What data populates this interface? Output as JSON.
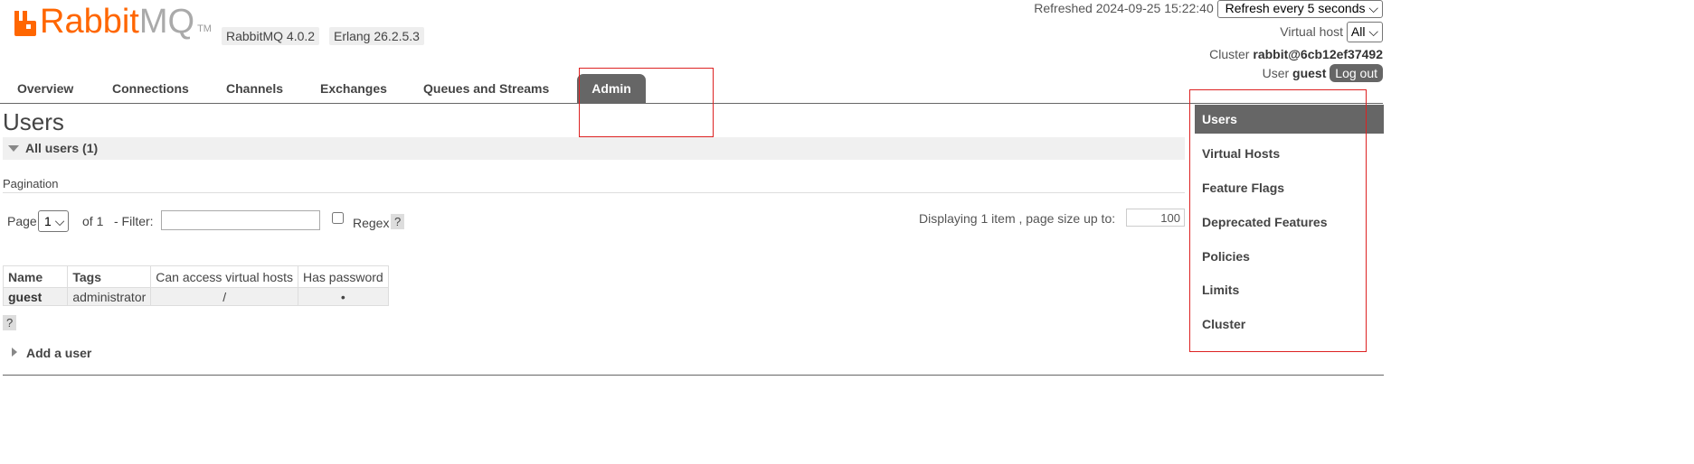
{
  "header": {
    "logo_rabbit": "Rabbit",
    "logo_mq": "MQ",
    "logo_tm": "TM",
    "version_rabbitmq": "RabbitMQ 4.0.2",
    "version_erlang": "Erlang 26.2.5.3",
    "refreshed_text": "Refreshed 2024-09-25 15:22:40",
    "refresh_select": "Refresh every 5 seconds",
    "vhost_label": "Virtual host",
    "vhost_select": "All",
    "cluster_label": "Cluster",
    "cluster_name": "rabbit@6cb12ef37492",
    "user_label": "User",
    "user_name": "guest",
    "logout_label": "Log out"
  },
  "nav": {
    "tabs": [
      "Overview",
      "Connections",
      "Channels",
      "Exchanges",
      "Queues and Streams",
      "Admin"
    ],
    "active": "Admin"
  },
  "main": {
    "title": "Users",
    "section_title": "All users (1)",
    "pagination_label": "Pagination",
    "page_label": "Page",
    "page_value": "1",
    "of_label": "of 1",
    "filter_label": "- Filter:",
    "filter_value": "",
    "regex_label": "Regex",
    "help_mark": "?",
    "displaying_text": "Displaying 1 item , page size up to:",
    "page_size": "100",
    "table": {
      "columns": [
        "Name",
        "Tags",
        "Can access virtual hosts",
        "Has password"
      ],
      "rows": [
        {
          "name": "guest",
          "tags": "administrator",
          "vhosts": "/",
          "has_password": "•"
        }
      ]
    },
    "table_help": "?",
    "add_user_label": "Add a user"
  },
  "sidebar": {
    "items": [
      "Users",
      "Virtual Hosts",
      "Feature Flags",
      "Deprecated Features",
      "Policies",
      "Limits",
      "Cluster"
    ],
    "active": "Users"
  },
  "colors": {
    "brand_orange": "#ff6600",
    "highlight_red": "#dd2222",
    "active_tab": "#666666"
  }
}
